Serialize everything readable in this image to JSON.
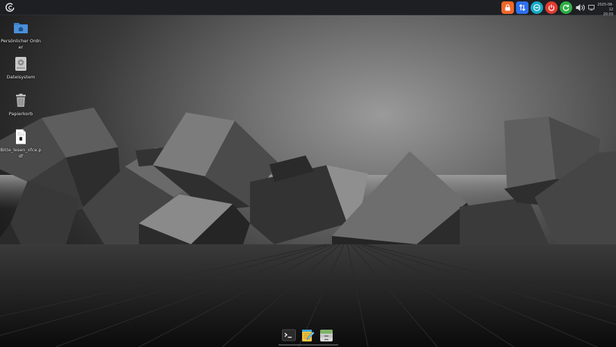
{
  "panel": {
    "menu_icon": "debian-swirl-icon",
    "tray": [
      {
        "name": "lock-screen-icon",
        "color": "#f0672a"
      },
      {
        "name": "network-transfer-icon",
        "color": "#2e6ff0"
      },
      {
        "name": "suspend-icon",
        "color": "#17a9c6"
      },
      {
        "name": "power-icon",
        "color": "#e23b30"
      },
      {
        "name": "restart-icon",
        "color": "#2fae44"
      },
      {
        "name": "volume-icon",
        "color": "#d8d8d8"
      }
    ],
    "clock": {
      "date": "2025-08-12",
      "time": "20:03"
    }
  },
  "desktop": {
    "icons": [
      {
        "name": "home-folder",
        "label": "Persönlicher Ordner",
        "icon": "home-folder-icon",
        "color": "#4a90d9"
      },
      {
        "name": "filesystem",
        "label": "Dateisystem",
        "icon": "harddisk-icon",
        "color": "#c9c9c9"
      },
      {
        "name": "trash",
        "label": "Papierkorb",
        "icon": "trash-icon",
        "color": "#bdbdbd"
      },
      {
        "name": "readme-pdf",
        "label": "Bitte_lesen_xfce.pdf",
        "icon": "pdf-document-icon",
        "color": "#ffffff"
      }
    ]
  },
  "dock": {
    "items": [
      {
        "name": "terminal",
        "icon": "terminal-icon",
        "color": "#2b2b2b"
      },
      {
        "name": "text-editor",
        "icon": "notepad-icon",
        "color": "#f5c542"
      },
      {
        "name": "file-manager",
        "icon": "file-cabinet-icon",
        "color": "#7fb36a"
      }
    ]
  }
}
